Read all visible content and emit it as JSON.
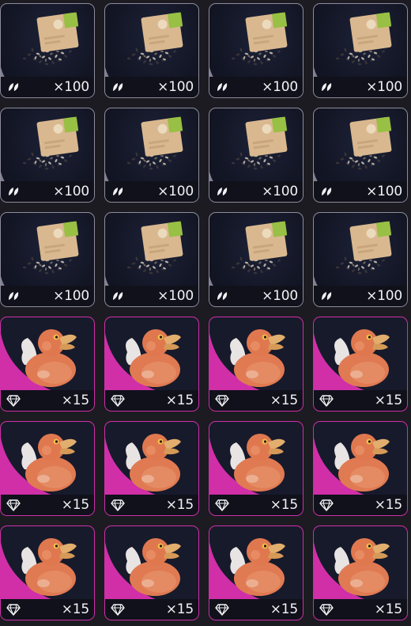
{
  "inventory": {
    "items": [
      {
        "type": "seed",
        "name": "seed-packet",
        "quantity": "×100",
        "rarity_icon": "leaf-icon",
        "rarity_color": "#8e8c9c"
      },
      {
        "type": "seed",
        "name": "seed-packet",
        "quantity": "×100",
        "rarity_icon": "leaf-icon",
        "rarity_color": "#8e8c9c"
      },
      {
        "type": "seed",
        "name": "seed-packet",
        "quantity": "×100",
        "rarity_icon": "leaf-icon",
        "rarity_color": "#8e8c9c"
      },
      {
        "type": "seed",
        "name": "seed-packet",
        "quantity": "×100",
        "rarity_icon": "leaf-icon",
        "rarity_color": "#8e8c9c"
      },
      {
        "type": "seed",
        "name": "seed-packet",
        "quantity": "×100",
        "rarity_icon": "leaf-icon",
        "rarity_color": "#8e8c9c"
      },
      {
        "type": "seed",
        "name": "seed-packet",
        "quantity": "×100",
        "rarity_icon": "leaf-icon",
        "rarity_color": "#8e8c9c"
      },
      {
        "type": "seed",
        "name": "seed-packet",
        "quantity": "×100",
        "rarity_icon": "leaf-icon",
        "rarity_color": "#8e8c9c"
      },
      {
        "type": "seed",
        "name": "seed-packet",
        "quantity": "×100",
        "rarity_icon": "leaf-icon",
        "rarity_color": "#8e8c9c"
      },
      {
        "type": "seed",
        "name": "seed-packet",
        "quantity": "×100",
        "rarity_icon": "leaf-icon",
        "rarity_color": "#8e8c9c"
      },
      {
        "type": "seed",
        "name": "seed-packet",
        "quantity": "×100",
        "rarity_icon": "leaf-icon",
        "rarity_color": "#8e8c9c"
      },
      {
        "type": "seed",
        "name": "seed-packet",
        "quantity": "×100",
        "rarity_icon": "leaf-icon",
        "rarity_color": "#8e8c9c"
      },
      {
        "type": "seed",
        "name": "seed-packet",
        "quantity": "×100",
        "rarity_icon": "leaf-icon",
        "rarity_color": "#8e8c9c"
      },
      {
        "type": "duck",
        "name": "rubber-duck",
        "quantity": "×15",
        "rarity_icon": "diamond-icon",
        "rarity_color": "#d02fa8"
      },
      {
        "type": "duck",
        "name": "rubber-duck",
        "quantity": "×15",
        "rarity_icon": "diamond-icon",
        "rarity_color": "#d02fa8"
      },
      {
        "type": "duck",
        "name": "rubber-duck",
        "quantity": "×15",
        "rarity_icon": "diamond-icon",
        "rarity_color": "#d02fa8"
      },
      {
        "type": "duck",
        "name": "rubber-duck",
        "quantity": "×15",
        "rarity_icon": "diamond-icon",
        "rarity_color": "#d02fa8"
      },
      {
        "type": "duck",
        "name": "rubber-duck",
        "quantity": "×15",
        "rarity_icon": "diamond-icon",
        "rarity_color": "#d02fa8"
      },
      {
        "type": "duck",
        "name": "rubber-duck",
        "quantity": "×15",
        "rarity_icon": "diamond-icon",
        "rarity_color": "#d02fa8"
      },
      {
        "type": "duck",
        "name": "rubber-duck",
        "quantity": "×15",
        "rarity_icon": "diamond-icon",
        "rarity_color": "#d02fa8"
      },
      {
        "type": "duck",
        "name": "rubber-duck",
        "quantity": "×15",
        "rarity_icon": "diamond-icon",
        "rarity_color": "#d02fa8"
      },
      {
        "type": "duck",
        "name": "rubber-duck",
        "quantity": "×15",
        "rarity_icon": "diamond-icon",
        "rarity_color": "#d02fa8"
      },
      {
        "type": "duck",
        "name": "rubber-duck",
        "quantity": "×15",
        "rarity_icon": "diamond-icon",
        "rarity_color": "#d02fa8"
      },
      {
        "type": "duck",
        "name": "rubber-duck",
        "quantity": "×15",
        "rarity_icon": "diamond-icon",
        "rarity_color": "#d02fa8"
      },
      {
        "type": "duck",
        "name": "rubber-duck",
        "quantity": "×15",
        "rarity_icon": "diamond-icon",
        "rarity_color": "#d02fa8"
      }
    ]
  }
}
